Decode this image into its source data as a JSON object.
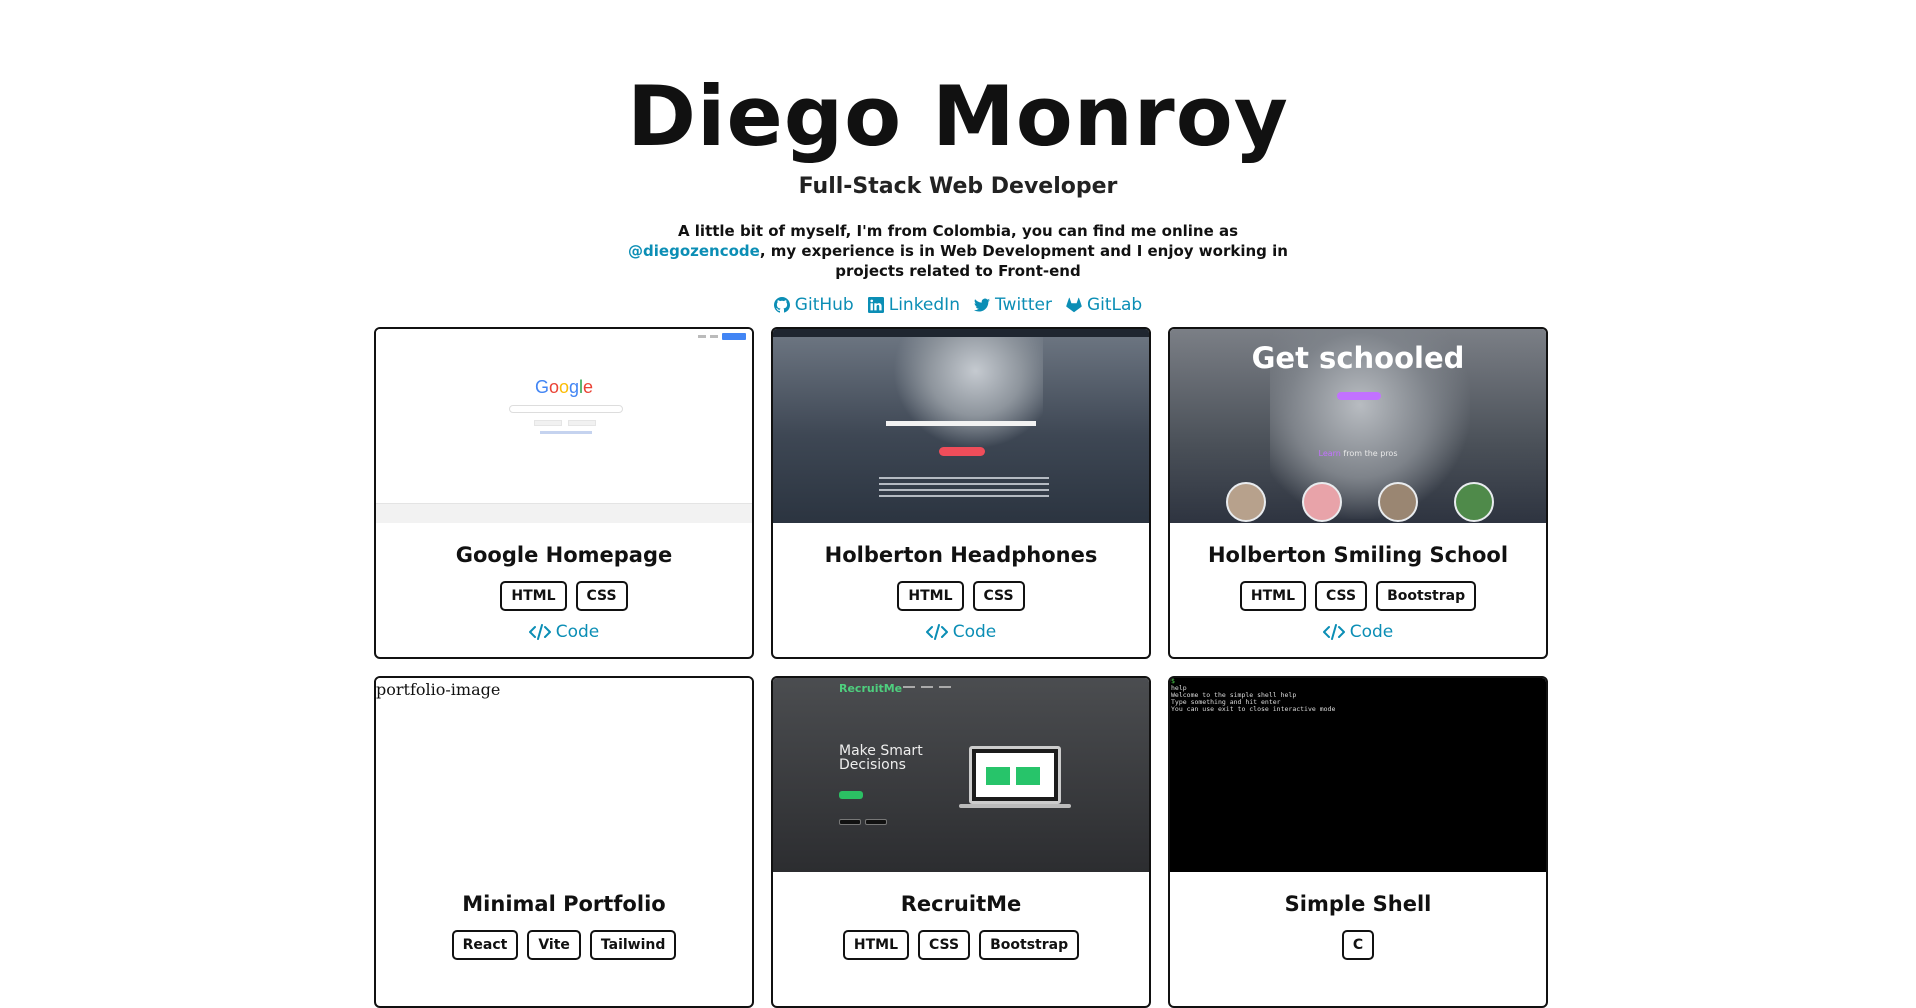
{
  "hero": {
    "name": "Diego Monroy",
    "role": "Full-Stack Web Developer",
    "bio_before": "A little bit of myself, I'm from Colombia, you can find me online as ",
    "handle": "@diegozencode",
    "bio_after": ", my experience is in Web Development and I enjoy working in projects related to Front-end"
  },
  "social": [
    {
      "label": "GitHub",
      "icon": "github-icon"
    },
    {
      "label": "LinkedIn",
      "icon": "linkedin-icon"
    },
    {
      "label": "Twitter",
      "icon": "twitter-icon"
    },
    {
      "label": "GitLab",
      "icon": "gitlab-icon"
    }
  ],
  "projects": [
    {
      "title": "Google Homepage",
      "tags": [
        "HTML",
        "CSS"
      ],
      "link": "Code"
    },
    {
      "title": "Holberton Headphones",
      "tags": [
        "HTML",
        "CSS"
      ],
      "link": "Code"
    },
    {
      "title": "Holberton Smiling School",
      "tags": [
        "HTML",
        "CSS",
        "Bootstrap"
      ],
      "link": "Code",
      "thumb": {
        "headline": "Get schooled",
        "learn_highlight": "Learn",
        "learn_rest": " from the pros"
      }
    },
    {
      "title": "Minimal Portfolio",
      "tags": [
        "React",
        "Vite",
        "Tailwind"
      ],
      "image_alt": "portfolio-image"
    },
    {
      "title": "RecruitMe",
      "tags": [
        "HTML",
        "CSS",
        "Bootstrap"
      ],
      "thumb": {
        "brand": "RecruitMe",
        "headline_1": "Make Smart",
        "headline_2": "Decisions"
      }
    },
    {
      "title": "Simple Shell",
      "tags": [
        "C"
      ],
      "thumb": {
        "terminal_lines": [
          "help",
          "Welcome to the simple shell help",
          "Type something and hit enter",
          "You can use exit to close interactive mode"
        ]
      }
    }
  ],
  "colors": {
    "link": "#0b8eb5",
    "text": "#111111",
    "border": "#111111"
  }
}
